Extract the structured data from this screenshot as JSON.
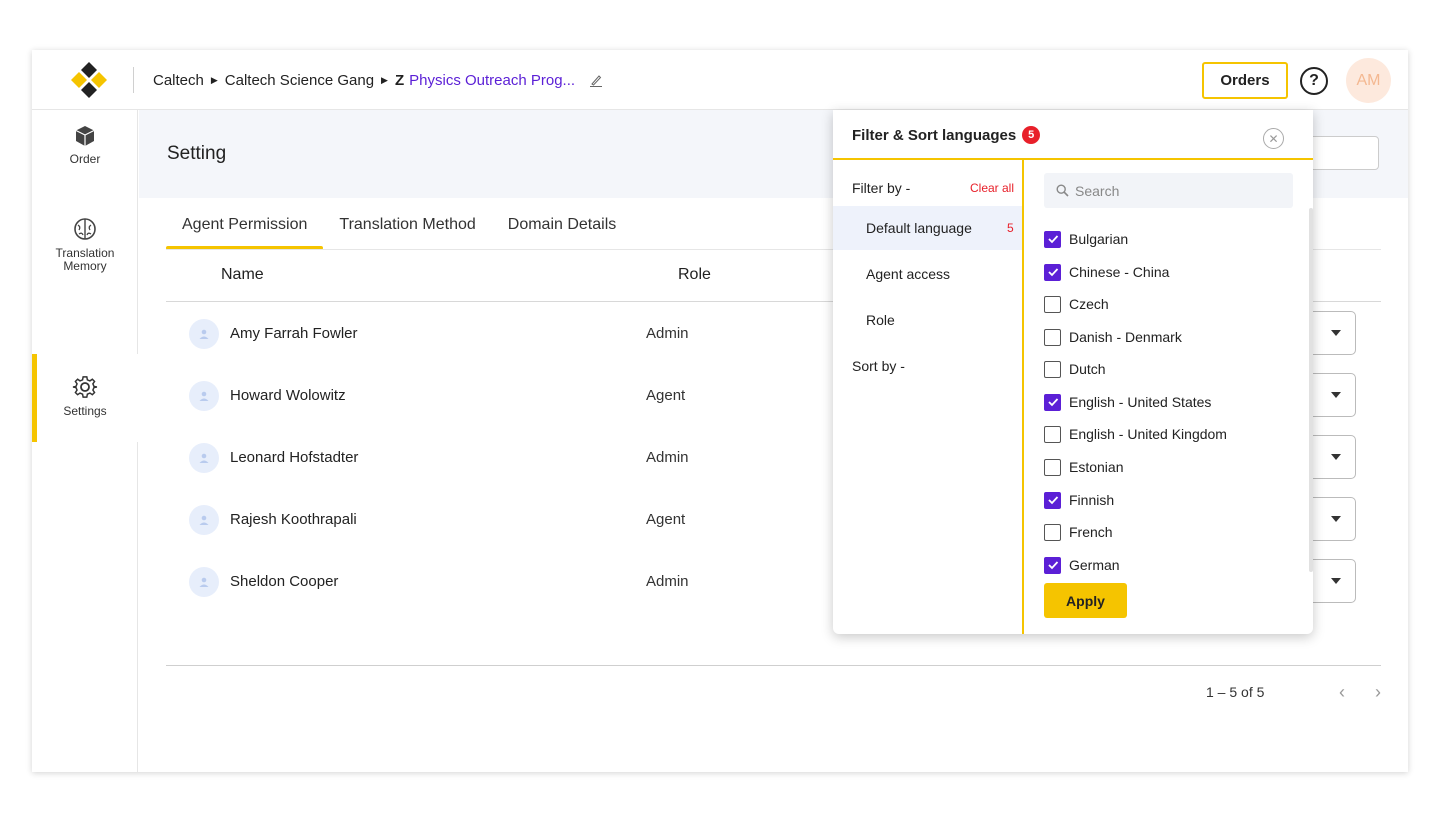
{
  "header": {
    "breadcrumb": [
      "Caltech",
      "Caltech Science Gang"
    ],
    "breadcrumb_zd_mark": "Z",
    "breadcrumb_current": "Physics Outreach Prog...",
    "orders_label": "Orders",
    "help_label": "?",
    "avatar_initials": "AM"
  },
  "sidebar": {
    "items": [
      {
        "label": "Order",
        "icon": "box-icon"
      },
      {
        "label": "Translation\nMemory",
        "icon": "brain-icon"
      },
      {
        "label": "Settings",
        "icon": "gear-icon"
      }
    ]
  },
  "page": {
    "title": "Setting",
    "tabs": [
      "Agent Permission",
      "Translation Method",
      "Domain Details"
    ],
    "columns": {
      "name": "Name",
      "role": "Role"
    },
    "rows": [
      {
        "name": "Amy Farrah Fowler",
        "role": "Admin"
      },
      {
        "name": "Howard Wolowitz",
        "role": "Agent"
      },
      {
        "name": "Leonard Hofstadter",
        "role": "Admin"
      },
      {
        "name": "Rajesh Koothrapali",
        "role": "Agent"
      },
      {
        "name": "Sheldon Cooper",
        "role": "Admin"
      }
    ],
    "pagination": "1 – 5 of 5",
    "prev": "‹",
    "next": "›"
  },
  "filter": {
    "title": "Filter & Sort languages",
    "badge": "5",
    "close": "✕",
    "filter_by": "Filter by -",
    "clear_all": "Clear all",
    "items": [
      {
        "label": "Default language",
        "count": "5"
      },
      {
        "label": "Agent access",
        "count": ""
      },
      {
        "label": "Role",
        "count": ""
      }
    ],
    "sort_by": "Sort by -",
    "search_placeholder": "Search",
    "languages": [
      {
        "label": "Bulgarian",
        "checked": true
      },
      {
        "label": "Chinese - China",
        "checked": true
      },
      {
        "label": "Czech",
        "checked": false
      },
      {
        "label": "Danish - Denmark",
        "checked": false
      },
      {
        "label": "Dutch",
        "checked": false
      },
      {
        "label": "English - United States",
        "checked": true
      },
      {
        "label": "English - United Kingdom",
        "checked": false
      },
      {
        "label": "Estonian",
        "checked": false
      },
      {
        "label": "Finnish",
        "checked": true
      },
      {
        "label": "French",
        "checked": false
      },
      {
        "label": "German",
        "checked": true
      }
    ],
    "apply_label": "Apply"
  },
  "colors": {
    "accent_yellow": "#f5c400",
    "brand_purple": "#5b1fd6",
    "alert_red": "#e8202a"
  }
}
